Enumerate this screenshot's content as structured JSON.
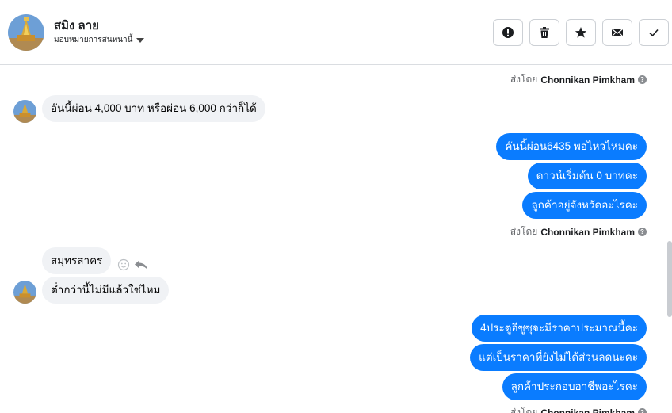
{
  "header": {
    "contact_name": "สมิง ลาย",
    "assign_label": "มอบหมายการสนทนานี้",
    "actions": [
      {
        "name": "spam-button",
        "icon": "alert-icon"
      },
      {
        "name": "delete-button",
        "icon": "trash-icon"
      },
      {
        "name": "star-button",
        "icon": "star-icon"
      },
      {
        "name": "mark-unread-button",
        "icon": "envelope-icon"
      },
      {
        "name": "mark-done-button",
        "icon": "checkmark-icon"
      }
    ]
  },
  "thread": {
    "sent_by_prefix": "ส่งโดย",
    "agent_name": "Chonnikan Pimkham",
    "messages": {
      "m1": "อันนี้ผ่อน 4,000 บาท หรือผ่อน 6,000 กว่าก็ได้",
      "m2": "คันนี้ผ่อน6435 พอไหวไหมคะ",
      "m3": "ดาวน์เริ่มต้น 0 บาทคะ",
      "m4": "ลูกค้าอยู่จังหวัดอะไรคะ",
      "m5": "สมุทรสาคร",
      "m6": "ต่ำกว่านี้ไม่มีแล้วใช่ไหม",
      "m7": "4ประตูอีซูซุจะมีราคาประมาณนี้คะ",
      "m8": "แต่เป็นราคาที่ยังไม่ได้ส่วนลดนะคะ",
      "m9": "ลูกค้าประกอบอาชีพอะไรคะ"
    }
  },
  "colors": {
    "outgoing_bubble": "#0a7cff",
    "incoming_bubble": "#f0f2f5"
  }
}
